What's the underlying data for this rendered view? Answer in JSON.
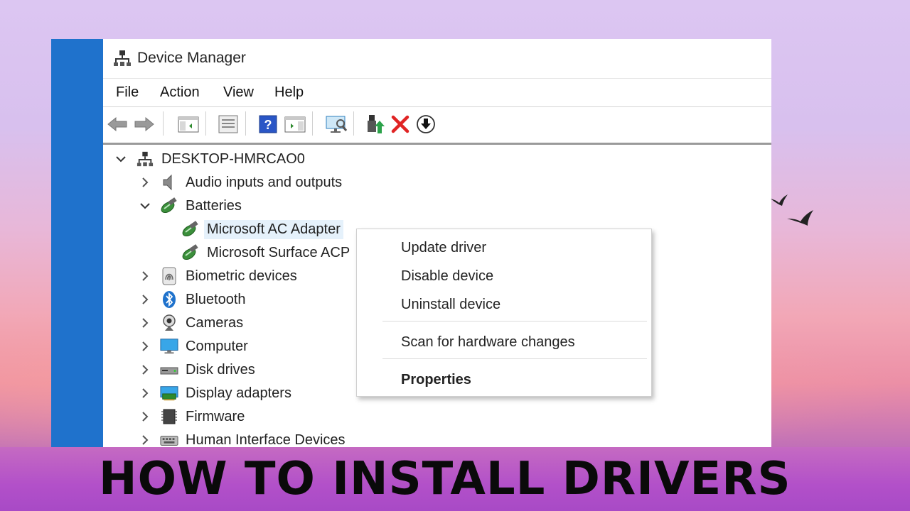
{
  "window": {
    "title": "Device Manager"
  },
  "menu": [
    "File",
    "Action",
    "View",
    "Help"
  ],
  "toolbar": [
    {
      "icon": "back-arrow-icon"
    },
    {
      "icon": "forward-arrow-icon"
    },
    {
      "icon": "show-hide-console-tree-icon"
    },
    {
      "icon": "properties-icon"
    },
    {
      "icon": "help-icon"
    },
    {
      "icon": "run-action-icon"
    },
    {
      "icon": "scan-hardware-icon"
    },
    {
      "icon": "update-driver-icon"
    },
    {
      "icon": "uninstall-icon"
    },
    {
      "icon": "download-driver-icon"
    }
  ],
  "tree": {
    "root": "DESKTOP-HMRCAO0",
    "items": [
      {
        "label": "Audio inputs and outputs",
        "expanded": false,
        "icon": "speaker-icon"
      },
      {
        "label": "Batteries",
        "expanded": true,
        "icon": "battery-icon"
      },
      {
        "label": "Microsoft AC Adapter",
        "child": true,
        "selected": true,
        "icon": "battery-icon"
      },
      {
        "label": "Microsoft Surface ACP",
        "child": true,
        "icon": "battery-icon"
      },
      {
        "label": "Biometric devices",
        "expanded": false,
        "icon": "fingerprint-icon"
      },
      {
        "label": "Bluetooth",
        "expanded": false,
        "icon": "bluetooth-icon"
      },
      {
        "label": "Cameras",
        "expanded": false,
        "icon": "camera-icon"
      },
      {
        "label": "Computer",
        "expanded": false,
        "icon": "monitor-icon"
      },
      {
        "label": "Disk drives",
        "expanded": false,
        "icon": "disk-drive-icon"
      },
      {
        "label": "Display adapters",
        "expanded": false,
        "icon": "display-adapter-icon"
      },
      {
        "label": "Firmware",
        "expanded": false,
        "icon": "firmware-chip-icon"
      },
      {
        "label": "Human Interface Devices",
        "expanded": false,
        "icon": "hid-icon"
      }
    ]
  },
  "context_menu": {
    "items": [
      {
        "label": "Update driver"
      },
      {
        "label": "Disable device"
      },
      {
        "label": "Uninstall device"
      },
      {
        "label": "Scan for hardware changes"
      },
      {
        "label": "Properties",
        "bold": true
      }
    ]
  },
  "headline": "HOW TO INSTALL DRIVERS",
  "colors": {
    "accent_blue": "#1f72cc",
    "uninstall_red": "#e02424",
    "selection": "#e5f1fb"
  }
}
